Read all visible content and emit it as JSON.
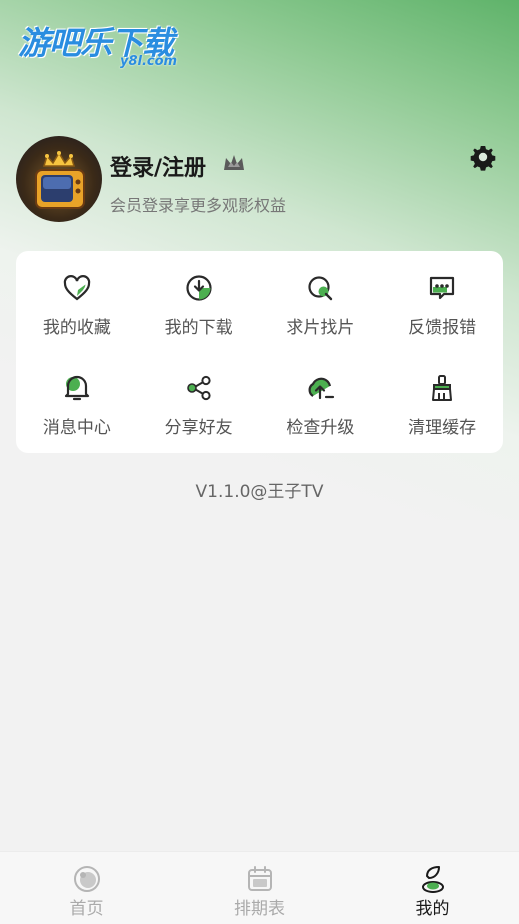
{
  "watermark": {
    "brand": "游吧乐下载",
    "domain": "y8l.com"
  },
  "profile": {
    "title": "登录/注册",
    "subtitle": "会员登录享更多观影权益",
    "avatar_icon": "tv-crown-avatar",
    "badge_icon": "crown-icon",
    "settings_icon": "gear-icon"
  },
  "menu": {
    "items": [
      {
        "label": "我的收藏",
        "icon": "heart-icon"
      },
      {
        "label": "我的下载",
        "icon": "download-icon"
      },
      {
        "label": "求片找片",
        "icon": "search-icon"
      },
      {
        "label": "反馈报错",
        "icon": "feedback-icon"
      },
      {
        "label": "消息中心",
        "icon": "bell-icon"
      },
      {
        "label": "分享好友",
        "icon": "share-icon"
      },
      {
        "label": "检查升级",
        "icon": "upgrade-icon"
      },
      {
        "label": "清理缓存",
        "icon": "broom-icon"
      }
    ]
  },
  "version": "V1.1.0@王子TV",
  "tabs": [
    {
      "label": "首页",
      "icon": "home-icon",
      "active": false
    },
    {
      "label": "排期表",
      "icon": "calendar-icon",
      "active": false
    },
    {
      "label": "我的",
      "icon": "user-icon",
      "active": true
    }
  ],
  "colors": {
    "accent": "#4caf50",
    "text": "#1a1a1a",
    "muted": "#777777"
  }
}
